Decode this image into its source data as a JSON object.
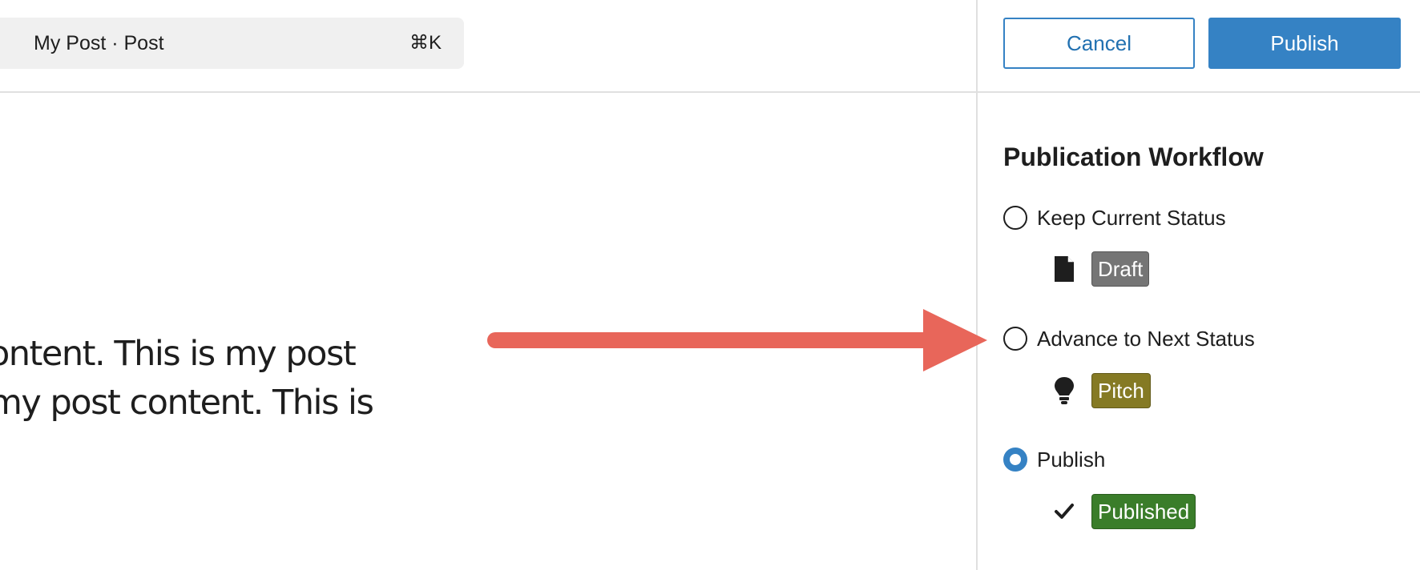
{
  "header": {
    "command_bar": {
      "title": "My Post · Post",
      "shortcut": "⌘K"
    },
    "cancel_label": "Cancel",
    "publish_label": "Publish"
  },
  "editor": {
    "content_lines": [
      "ontent. This is my post",
      "my post content. This is"
    ]
  },
  "annotation": {
    "arrow_color": "#e8665a"
  },
  "sidebar": {
    "title": "Publication Workflow",
    "options": [
      {
        "label": "Keep Current Status",
        "selected": false,
        "status": {
          "label": "Draft",
          "icon": "document-icon",
          "color": "#757575"
        }
      },
      {
        "label": "Advance to Next Status",
        "selected": false,
        "status": {
          "label": "Pitch",
          "icon": "lightbulb-icon",
          "color": "#857a24"
        }
      },
      {
        "label": "Publish",
        "selected": true,
        "status": {
          "label": "Published",
          "icon": "checkmark-icon",
          "color": "#3a7d2a"
        }
      }
    ]
  },
  "colors": {
    "accent": "#3582c4",
    "divider": "#e0e0e0"
  }
}
